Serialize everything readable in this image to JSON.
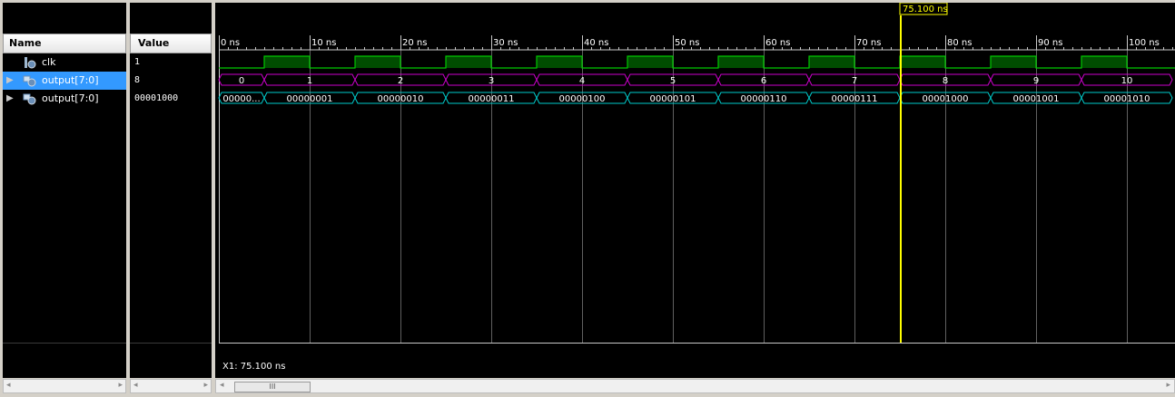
{
  "columns": {
    "name": "Name",
    "value": "Value"
  },
  "signals": [
    {
      "name": "clk",
      "value": "1",
      "icon": "bit-signal-icon",
      "expandable": false,
      "selected": false
    },
    {
      "name": "output[7:0]",
      "value": "8",
      "icon": "bus-signal-icon",
      "expandable": true,
      "selected": true
    },
    {
      "name": "output[7:0]",
      "value": "00001000",
      "icon": "bus-signal-icon",
      "expandable": true,
      "selected": false
    }
  ],
  "timeline": {
    "unit": "ns",
    "start": 0,
    "end": 105,
    "major_step": 10,
    "labels": [
      "0 ns",
      "10 ns",
      "20 ns",
      "30 ns",
      "40 ns",
      "50 ns",
      "60 ns",
      "70 ns",
      "80 ns",
      "90 ns",
      "100 ns"
    ]
  },
  "cursor": {
    "time": 75.1,
    "label": "75.100 ns",
    "readout": "X1: 75.100 ns"
  },
  "clock": {
    "period": 10,
    "high_phase_start": 5,
    "high_phase_end": 10
  },
  "bus_decimal": [
    {
      "t0": 0,
      "t1": 5,
      "text": "0"
    },
    {
      "t0": 5,
      "t1": 15,
      "text": "1"
    },
    {
      "t0": 15,
      "t1": 25,
      "text": "2"
    },
    {
      "t0": 25,
      "t1": 35,
      "text": "3"
    },
    {
      "t0": 35,
      "t1": 45,
      "text": "4"
    },
    {
      "t0": 45,
      "t1": 55,
      "text": "5"
    },
    {
      "t0": 55,
      "t1": 65,
      "text": "6"
    },
    {
      "t0": 65,
      "t1": 75,
      "text": "7"
    },
    {
      "t0": 75,
      "t1": 85,
      "text": "8"
    },
    {
      "t0": 85,
      "t1": 95,
      "text": "9"
    },
    {
      "t0": 95,
      "t1": 105,
      "text": "10"
    }
  ],
  "bus_binary": [
    {
      "t0": 0,
      "t1": 5,
      "text": "00000..."
    },
    {
      "t0": 5,
      "t1": 15,
      "text": "00000001"
    },
    {
      "t0": 15,
      "t1": 25,
      "text": "00000010"
    },
    {
      "t0": 25,
      "t1": 35,
      "text": "00000011"
    },
    {
      "t0": 35,
      "t1": 45,
      "text": "00000100"
    },
    {
      "t0": 45,
      "t1": 55,
      "text": "00000101"
    },
    {
      "t0": 55,
      "t1": 65,
      "text": "00000110"
    },
    {
      "t0": 65,
      "t1": 75,
      "text": "00000111"
    },
    {
      "t0": 75,
      "t1": 85,
      "text": "00001000"
    },
    {
      "t0": 85,
      "t1": 95,
      "text": "00001001"
    },
    {
      "t0": 95,
      "t1": 105,
      "text": "00001010"
    }
  ],
  "scroll": {
    "thumb_glyph": "III"
  },
  "colors": {
    "clock": "#00c800",
    "clock_fill": "#004d00",
    "bus_decimal": "#cc00cc",
    "bus_binary": "#00cccc",
    "cursor": "#ffff00",
    "grid": "#c8c8c8",
    "text": "#ffffff"
  }
}
